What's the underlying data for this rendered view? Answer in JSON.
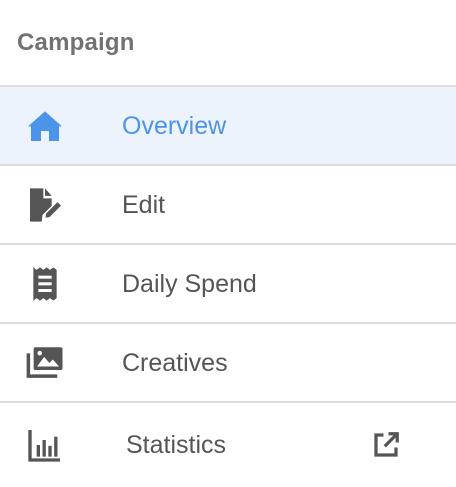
{
  "campaign_nav": {
    "title": "Campaign",
    "active_color": "#4c94ea",
    "text_color": "#555555",
    "items": [
      {
        "label": "Overview",
        "icon": "home-icon",
        "active": true
      },
      {
        "label": "Edit",
        "icon": "file-edit-icon",
        "active": false
      },
      {
        "label": "Daily Spend",
        "icon": "receipt-icon",
        "active": false
      },
      {
        "label": "Creatives",
        "icon": "images-icon",
        "active": false
      },
      {
        "label": "Statistics",
        "icon": "bar-chart-icon",
        "active": false,
        "trailing_icon": "external-link-icon"
      }
    ]
  }
}
